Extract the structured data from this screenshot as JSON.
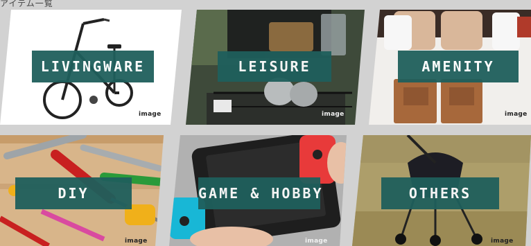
{
  "heading": "アイテム一覧",
  "categories": [
    {
      "label": "LIVINGWARE",
      "image_tag": "image",
      "icon": "bicycle-icon"
    },
    {
      "label": "LEISURE",
      "image_tag": "image",
      "icon": "camping-cookware-icon"
    },
    {
      "label": "AMENITY",
      "image_tag": "image",
      "icon": "towel-bed-icon"
    },
    {
      "label": "DIY",
      "image_tag": "image",
      "icon": "tools-icon"
    },
    {
      "label": "GAME & HOBBY",
      "image_tag": "image",
      "icon": "game-console-icon"
    },
    {
      "label": "OTHERS",
      "image_tag": "image",
      "icon": "stroller-icon"
    }
  ],
  "colors": {
    "background": "#d2d2d2",
    "label_bg": "#1f5f5c",
    "label_text": "#ffffff"
  }
}
